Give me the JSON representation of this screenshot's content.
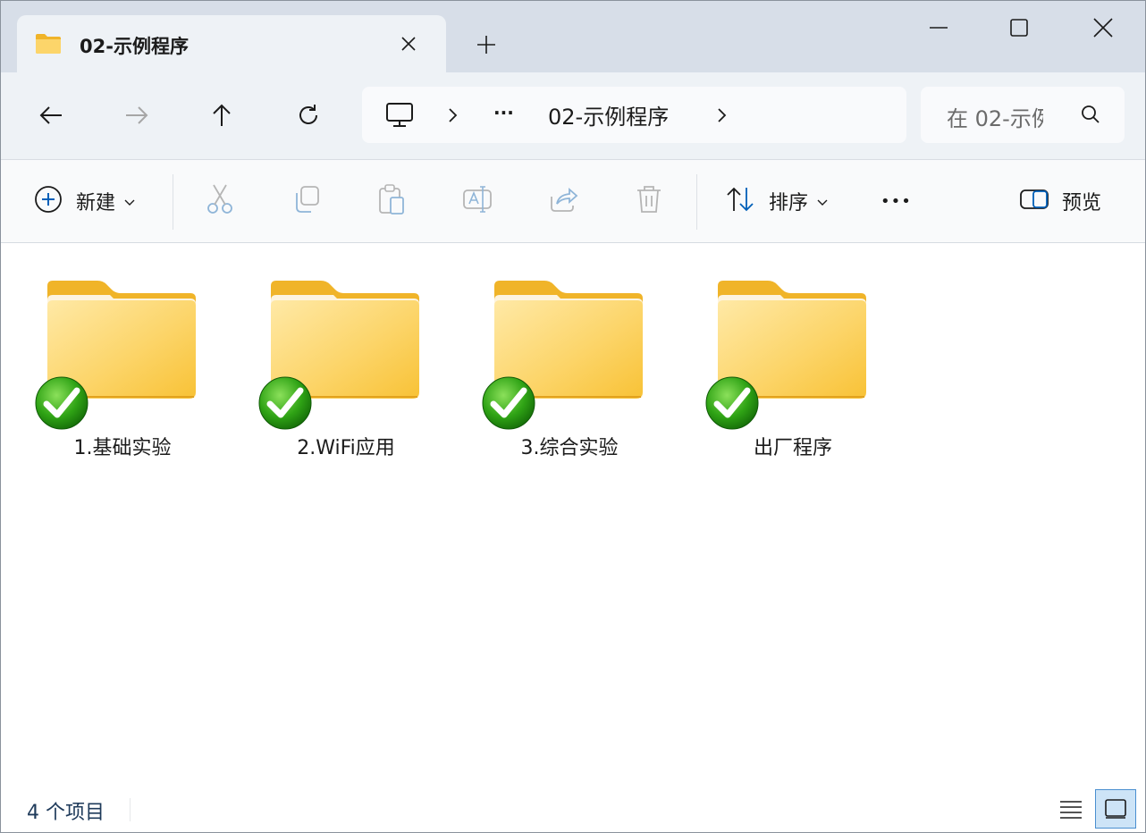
{
  "tab": {
    "title": "02-示例程序"
  },
  "address": {
    "more": "···",
    "current": "02-示例程序"
  },
  "search": {
    "placeholder": "在 02-示例"
  },
  "toolbar": {
    "new_label": "新建",
    "sort_label": "排序",
    "more_label": "•••",
    "preview_label": "预览"
  },
  "folders": [
    {
      "name": "1.基础实验",
      "sync_status": "synced"
    },
    {
      "name": "2.WiFi应用",
      "sync_status": "synced"
    },
    {
      "name": "3.综合实验",
      "sync_status": "synced"
    },
    {
      "name": "出厂程序",
      "sync_status": "synced"
    }
  ],
  "status": {
    "count": "4 个项目"
  },
  "colors": {
    "accent": "#005fb8",
    "folder": "#f7c545",
    "sync_badge": "#2fa315"
  },
  "icons": [
    "folder-icon",
    "close-icon",
    "plus-icon",
    "minimize-icon",
    "maximize-icon",
    "back-arrow-icon",
    "forward-arrow-icon",
    "up-arrow-icon",
    "refresh-icon",
    "monitor-icon",
    "chevron-right-icon",
    "search-icon",
    "add-circle-icon",
    "chevron-down-icon",
    "cut-icon",
    "copy-icon",
    "paste-icon",
    "rename-icon",
    "share-icon",
    "delete-icon",
    "sort-icon",
    "preview-pane-icon",
    "details-view-icon",
    "tiles-view-icon",
    "checkmark-badge-icon"
  ]
}
